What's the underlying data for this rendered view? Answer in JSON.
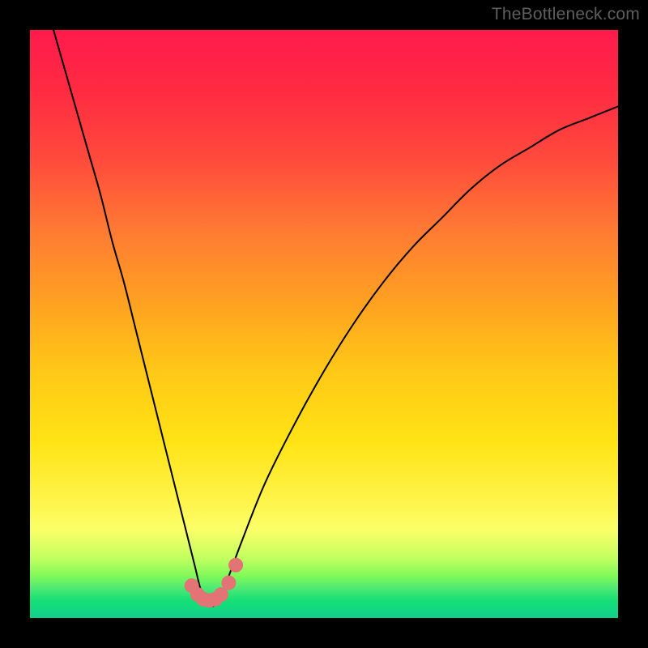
{
  "watermark": "TheBottleneck.com",
  "chart_data": {
    "type": "line",
    "title": "",
    "xlabel": "",
    "ylabel": "",
    "xlim": [
      0,
      100
    ],
    "ylim": [
      0,
      100
    ],
    "grid": false,
    "series": [
      {
        "name": "bottleneck-curve",
        "x": [
          4,
          6,
          8,
          10,
          12,
          14,
          16,
          18,
          20,
          22,
          24,
          26,
          28,
          29,
          30,
          31,
          32,
          33,
          36,
          40,
          45,
          50,
          55,
          60,
          65,
          70,
          75,
          80,
          85,
          90,
          95,
          100
        ],
        "y": [
          100,
          93,
          86,
          79,
          72,
          64,
          57,
          49,
          41,
          33,
          25,
          17,
          9,
          5,
          3,
          2,
          3,
          5,
          13,
          23,
          33,
          42,
          50,
          57,
          63,
          68,
          73,
          77,
          80,
          83,
          85,
          87
        ]
      }
    ],
    "markers": {
      "name": "highlight-dots",
      "color": "#e37374",
      "points": [
        {
          "x": 27.5,
          "y": 5.5
        },
        {
          "x": 28.5,
          "y": 4.0
        },
        {
          "x": 29.5,
          "y": 3.2
        },
        {
          "x": 30.5,
          "y": 3.0
        },
        {
          "x": 31.5,
          "y": 3.2
        },
        {
          "x": 32.5,
          "y": 4.0
        },
        {
          "x": 33.8,
          "y": 6.0
        },
        {
          "x": 35.0,
          "y": 9.0
        }
      ]
    },
    "background_gradient": {
      "stops": [
        {
          "pos": 0.0,
          "color": "#ff1b4c"
        },
        {
          "pos": 0.5,
          "color": "#ffc817"
        },
        {
          "pos": 0.85,
          "color": "#fbff68"
        },
        {
          "pos": 1.0,
          "color": "#12cf8e"
        }
      ]
    }
  }
}
